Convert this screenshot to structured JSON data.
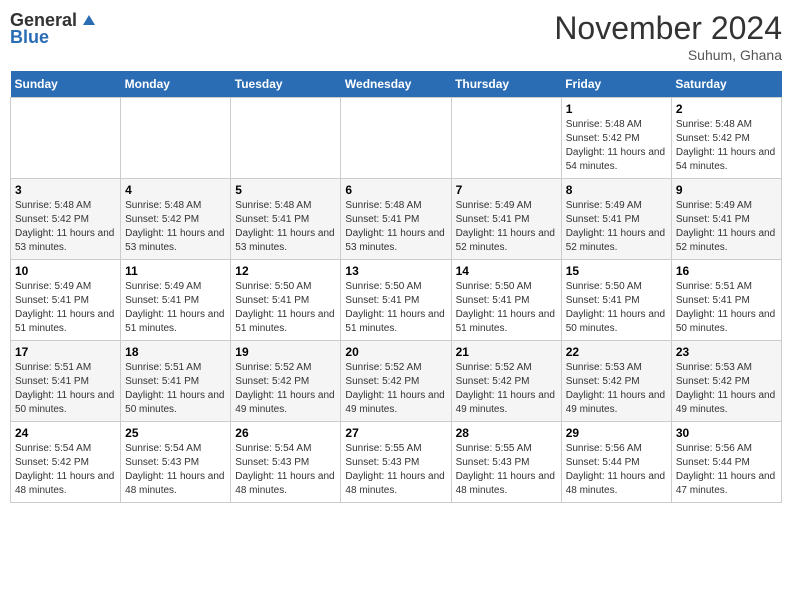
{
  "header": {
    "logo_line1": "General",
    "logo_line2": "Blue",
    "month": "November 2024",
    "location": "Suhum, Ghana"
  },
  "weekdays": [
    "Sunday",
    "Monday",
    "Tuesday",
    "Wednesday",
    "Thursday",
    "Friday",
    "Saturday"
  ],
  "weeks": [
    [
      {
        "day": "",
        "sunrise": "",
        "sunset": "",
        "daylight": ""
      },
      {
        "day": "",
        "sunrise": "",
        "sunset": "",
        "daylight": ""
      },
      {
        "day": "",
        "sunrise": "",
        "sunset": "",
        "daylight": ""
      },
      {
        "day": "",
        "sunrise": "",
        "sunset": "",
        "daylight": ""
      },
      {
        "day": "",
        "sunrise": "",
        "sunset": "",
        "daylight": ""
      },
      {
        "day": "1",
        "sunrise": "Sunrise: 5:48 AM",
        "sunset": "Sunset: 5:42 PM",
        "daylight": "Daylight: 11 hours and 54 minutes."
      },
      {
        "day": "2",
        "sunrise": "Sunrise: 5:48 AM",
        "sunset": "Sunset: 5:42 PM",
        "daylight": "Daylight: 11 hours and 54 minutes."
      }
    ],
    [
      {
        "day": "3",
        "sunrise": "Sunrise: 5:48 AM",
        "sunset": "Sunset: 5:42 PM",
        "daylight": "Daylight: 11 hours and 53 minutes."
      },
      {
        "day": "4",
        "sunrise": "Sunrise: 5:48 AM",
        "sunset": "Sunset: 5:42 PM",
        "daylight": "Daylight: 11 hours and 53 minutes."
      },
      {
        "day": "5",
        "sunrise": "Sunrise: 5:48 AM",
        "sunset": "Sunset: 5:41 PM",
        "daylight": "Daylight: 11 hours and 53 minutes."
      },
      {
        "day": "6",
        "sunrise": "Sunrise: 5:48 AM",
        "sunset": "Sunset: 5:41 PM",
        "daylight": "Daylight: 11 hours and 53 minutes."
      },
      {
        "day": "7",
        "sunrise": "Sunrise: 5:49 AM",
        "sunset": "Sunset: 5:41 PM",
        "daylight": "Daylight: 11 hours and 52 minutes."
      },
      {
        "day": "8",
        "sunrise": "Sunrise: 5:49 AM",
        "sunset": "Sunset: 5:41 PM",
        "daylight": "Daylight: 11 hours and 52 minutes."
      },
      {
        "day": "9",
        "sunrise": "Sunrise: 5:49 AM",
        "sunset": "Sunset: 5:41 PM",
        "daylight": "Daylight: 11 hours and 52 minutes."
      }
    ],
    [
      {
        "day": "10",
        "sunrise": "Sunrise: 5:49 AM",
        "sunset": "Sunset: 5:41 PM",
        "daylight": "Daylight: 11 hours and 51 minutes."
      },
      {
        "day": "11",
        "sunrise": "Sunrise: 5:49 AM",
        "sunset": "Sunset: 5:41 PM",
        "daylight": "Daylight: 11 hours and 51 minutes."
      },
      {
        "day": "12",
        "sunrise": "Sunrise: 5:50 AM",
        "sunset": "Sunset: 5:41 PM",
        "daylight": "Daylight: 11 hours and 51 minutes."
      },
      {
        "day": "13",
        "sunrise": "Sunrise: 5:50 AM",
        "sunset": "Sunset: 5:41 PM",
        "daylight": "Daylight: 11 hours and 51 minutes."
      },
      {
        "day": "14",
        "sunrise": "Sunrise: 5:50 AM",
        "sunset": "Sunset: 5:41 PM",
        "daylight": "Daylight: 11 hours and 51 minutes."
      },
      {
        "day": "15",
        "sunrise": "Sunrise: 5:50 AM",
        "sunset": "Sunset: 5:41 PM",
        "daylight": "Daylight: 11 hours and 50 minutes."
      },
      {
        "day": "16",
        "sunrise": "Sunrise: 5:51 AM",
        "sunset": "Sunset: 5:41 PM",
        "daylight": "Daylight: 11 hours and 50 minutes."
      }
    ],
    [
      {
        "day": "17",
        "sunrise": "Sunrise: 5:51 AM",
        "sunset": "Sunset: 5:41 PM",
        "daylight": "Daylight: 11 hours and 50 minutes."
      },
      {
        "day": "18",
        "sunrise": "Sunrise: 5:51 AM",
        "sunset": "Sunset: 5:41 PM",
        "daylight": "Daylight: 11 hours and 50 minutes."
      },
      {
        "day": "19",
        "sunrise": "Sunrise: 5:52 AM",
        "sunset": "Sunset: 5:42 PM",
        "daylight": "Daylight: 11 hours and 49 minutes."
      },
      {
        "day": "20",
        "sunrise": "Sunrise: 5:52 AM",
        "sunset": "Sunset: 5:42 PM",
        "daylight": "Daylight: 11 hours and 49 minutes."
      },
      {
        "day": "21",
        "sunrise": "Sunrise: 5:52 AM",
        "sunset": "Sunset: 5:42 PM",
        "daylight": "Daylight: 11 hours and 49 minutes."
      },
      {
        "day": "22",
        "sunrise": "Sunrise: 5:53 AM",
        "sunset": "Sunset: 5:42 PM",
        "daylight": "Daylight: 11 hours and 49 minutes."
      },
      {
        "day": "23",
        "sunrise": "Sunrise: 5:53 AM",
        "sunset": "Sunset: 5:42 PM",
        "daylight": "Daylight: 11 hours and 49 minutes."
      }
    ],
    [
      {
        "day": "24",
        "sunrise": "Sunrise: 5:54 AM",
        "sunset": "Sunset: 5:42 PM",
        "daylight": "Daylight: 11 hours and 48 minutes."
      },
      {
        "day": "25",
        "sunrise": "Sunrise: 5:54 AM",
        "sunset": "Sunset: 5:43 PM",
        "daylight": "Daylight: 11 hours and 48 minutes."
      },
      {
        "day": "26",
        "sunrise": "Sunrise: 5:54 AM",
        "sunset": "Sunset: 5:43 PM",
        "daylight": "Daylight: 11 hours and 48 minutes."
      },
      {
        "day": "27",
        "sunrise": "Sunrise: 5:55 AM",
        "sunset": "Sunset: 5:43 PM",
        "daylight": "Daylight: 11 hours and 48 minutes."
      },
      {
        "day": "28",
        "sunrise": "Sunrise: 5:55 AM",
        "sunset": "Sunset: 5:43 PM",
        "daylight": "Daylight: 11 hours and 48 minutes."
      },
      {
        "day": "29",
        "sunrise": "Sunrise: 5:56 AM",
        "sunset": "Sunset: 5:44 PM",
        "daylight": "Daylight: 11 hours and 48 minutes."
      },
      {
        "day": "30",
        "sunrise": "Sunrise: 5:56 AM",
        "sunset": "Sunset: 5:44 PM",
        "daylight": "Daylight: 11 hours and 47 minutes."
      }
    ]
  ]
}
